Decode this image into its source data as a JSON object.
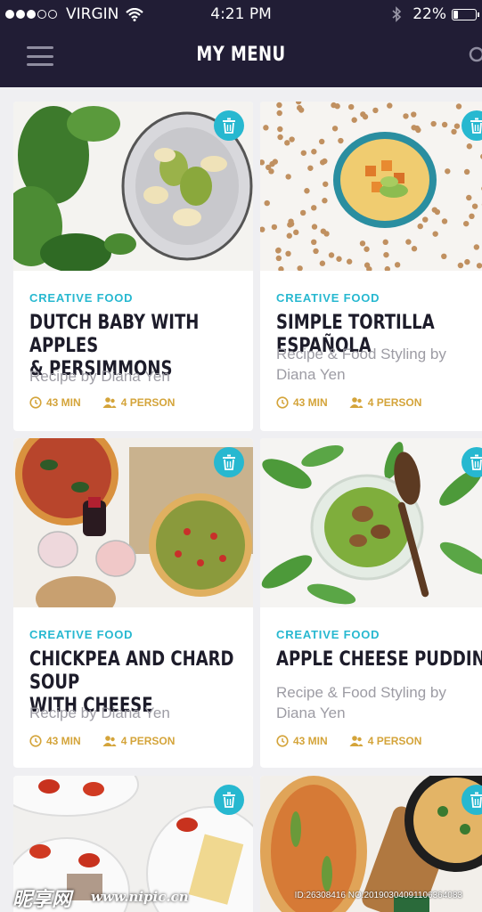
{
  "status_bar": {
    "carrier": "VIRGIN",
    "time": "4:21 PM",
    "battery": "22%",
    "battery_level": 0.22
  },
  "header": {
    "title": "MY MENU"
  },
  "cards": [
    {
      "category": "CREATIVE FOOD",
      "name_line1": "DUTCH BABY WITH APPLES",
      "name_line2": "& PERSIMMONS",
      "byline_line1": "Recipe by Diana Yen",
      "byline_line2": "",
      "time": "43 MIN",
      "persons": "4 PERSON"
    },
    {
      "category": "CREATIVE FOOD",
      "name_line1": "SIMPLE TORTILLA ESPAÑOLA",
      "name_line2": "",
      "byline_line1": "Recipe & Food Styling by",
      "byline_line2": "Diana Yen",
      "time": "43 MIN",
      "persons": "4 PERSON"
    },
    {
      "category": "CREATIVE FOOD",
      "name_line1": "CHICKPEA AND CHARD SOUP",
      "name_line2": "WITH CHEESE",
      "byline_line1": "Recipe by Diana Yen",
      "byline_line2": "",
      "time": "43 MIN",
      "persons": "4 PERSON"
    },
    {
      "category": "CREATIVE FOOD",
      "name_line1": "APPLE CHEESE PUDDING",
      "name_line2": "",
      "byline_line1": "Recipe & Food Styling by",
      "byline_line2": "Diana Yen",
      "time": "43 MIN",
      "persons": "4 PERSON"
    }
  ],
  "watermark": {
    "logo": "昵享网",
    "site": "www.nipic.cn",
    "id": "ID:26308416 NO:20190304091106364083"
  },
  "colors": {
    "nav": "#211d35",
    "accent": "#27b8d0",
    "meta": "#d4a43a",
    "background": "#efeff2"
  }
}
